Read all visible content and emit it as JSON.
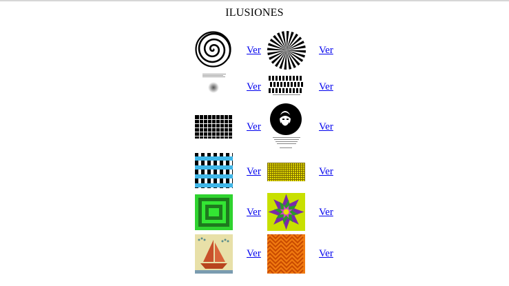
{
  "page": {
    "title": "ILUSIONES"
  },
  "gallery": {
    "link_label": "Ver",
    "items": [
      {
        "icon": "spiral-illusion-icon"
      },
      {
        "icon": "radial-rays-illusion-icon"
      },
      {
        "icon": "fading-dot-illusion-icon"
      },
      {
        "icon": "wave-pattern-illusion-icon"
      },
      {
        "icon": "hermann-grid-illusion-icon"
      },
      {
        "icon": "portrait-illusion-icon"
      },
      {
        "icon": "blue-stripes-illusion-icon"
      },
      {
        "icon": "yellow-grid-illusion-icon"
      },
      {
        "icon": "green-squares-illusion-icon"
      },
      {
        "icon": "star-kaleidoscope-illusion-icon"
      },
      {
        "icon": "sailboat-mosaic-illusion-icon"
      },
      {
        "icon": "orange-zigzag-illusion-icon"
      }
    ]
  },
  "colors": {
    "link": "#0000ee",
    "text": "#000000"
  }
}
